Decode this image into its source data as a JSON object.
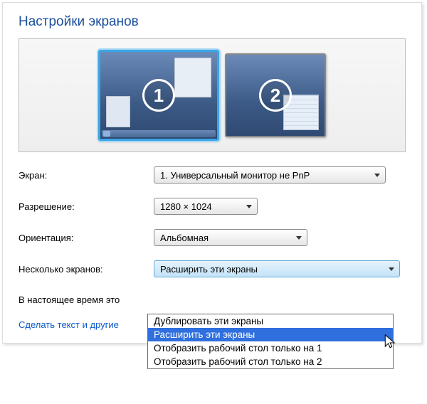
{
  "title": "Настройки экранов",
  "monitors": {
    "m1": "1",
    "m2": "2"
  },
  "labels": {
    "display": "Экран:",
    "resolution": "Разрешение:",
    "orientation": "Ориентация:",
    "multiple": "Несколько экранов:"
  },
  "values": {
    "display": "1. Универсальный монитор не PnP",
    "resolution": "1280 × 1024",
    "orientation": "Альбомная",
    "multiple": "Расширить эти экраны"
  },
  "multi_options": {
    "o0": "Дублировать эти экраны",
    "o1": "Расширить эти экраны",
    "o2": "Отобразить рабочий стол только на 1",
    "o3": "Отобразить рабочий стол только на 2"
  },
  "note_partial": "В настоящее время это",
  "link_partial": "Сделать текст и другие"
}
